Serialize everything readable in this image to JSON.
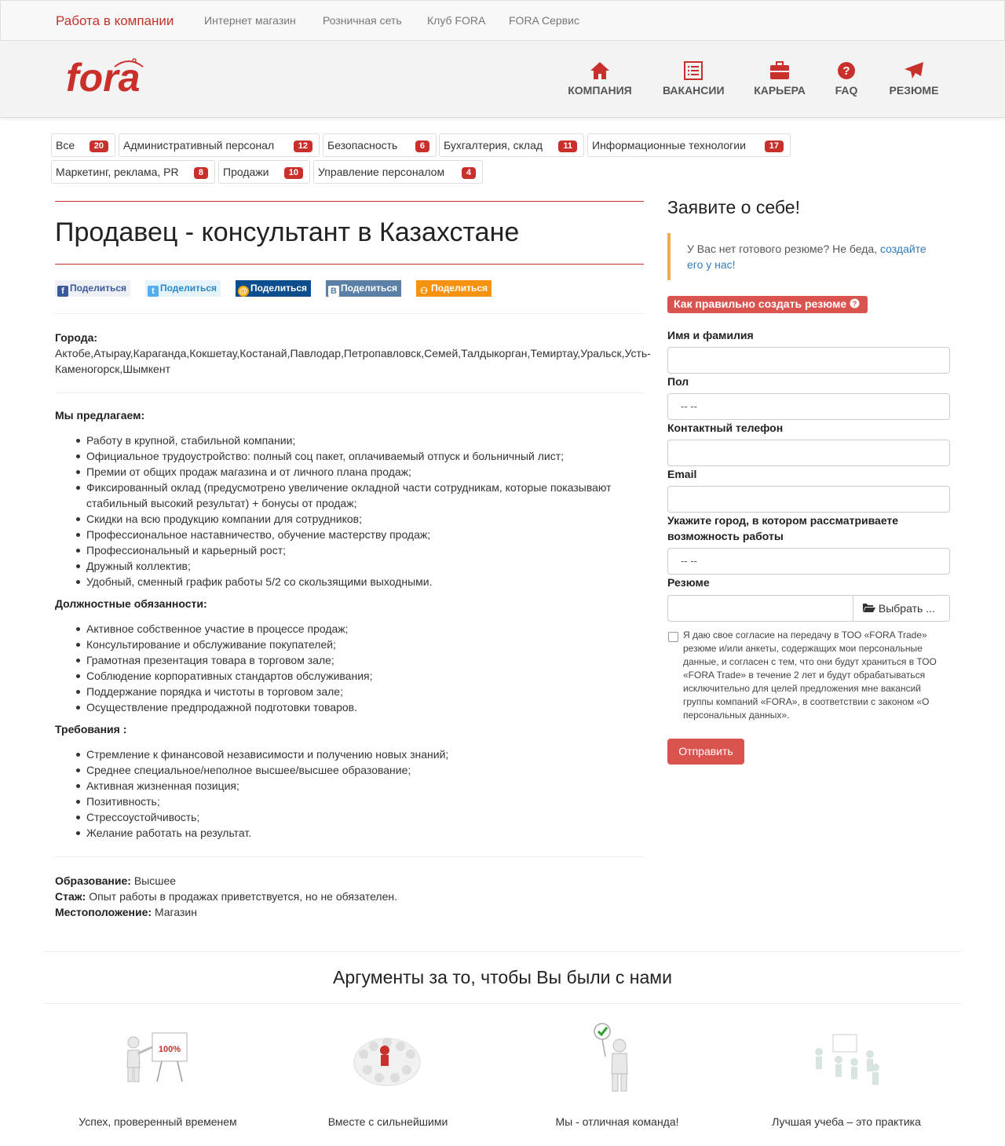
{
  "topnav": {
    "items": [
      "Работа в компании",
      "Интернет магазин",
      "Розничная сеть",
      "Клуб FORA",
      "FORA Сервис"
    ]
  },
  "header": {
    "logo_text": "fora",
    "brand_color": "#c9302c",
    "nav": [
      {
        "label": "КОМПАНИЯ",
        "icon": "home-icon"
      },
      {
        "label": "ВАКАНСИИ",
        "icon": "list-icon"
      },
      {
        "label": "КАРЬЕРА",
        "icon": "briefcase-icon"
      },
      {
        "label": "FAQ",
        "icon": "question-icon"
      },
      {
        "label": "РЕЗЮМЕ",
        "icon": "send-icon"
      }
    ]
  },
  "categories": [
    {
      "label": "Все",
      "count": "20"
    },
    {
      "label": "Административный персонал",
      "count": "12"
    },
    {
      "label": "Безопасность",
      "count": "6"
    },
    {
      "label": "Бухгалтерия, склад",
      "count": "11"
    },
    {
      "label": "Информационные технологии",
      "count": "17"
    },
    {
      "label": "Маркетинг, реклама, PR",
      "count": "8"
    },
    {
      "label": "Продажи",
      "count": "10"
    },
    {
      "label": "Управление персоналом",
      "count": "4"
    }
  ],
  "vacancy": {
    "title": "Продавец - консультант в Казахстане",
    "share": [
      {
        "label": "Поделиться",
        "network": "facebook",
        "icon": "facebook-icon",
        "color": "#3b5998"
      },
      {
        "label": "Поделиться",
        "network": "twitter",
        "icon": "twitter-icon",
        "color": "#55acee"
      },
      {
        "label": "Поделиться",
        "network": "mailru",
        "icon": "mailru-icon",
        "color": "#168de2"
      },
      {
        "label": "Поделиться",
        "network": "vk",
        "icon": "vk-icon",
        "color": "#5b7fa6"
      },
      {
        "label": "Поделиться",
        "network": "odnoklassniki",
        "icon": "ok-icon",
        "color": "#f59310"
      }
    ],
    "cities_label": "Города:",
    "cities_line1": "Актобе,Атырау,Караганда,Кокшетау,Костанай,Павлодар,Петропавловск,Семей,Талдыкорган,Темиртау,Уральск,Усть-",
    "cities_line2": "Каменогорск,Шымкент",
    "offer_title": "Мы предлагаем:",
    "offer": [
      "Работу в крупной, стабильной компании;",
      "Официальное трудоустройство: полный соц пакет, оплачиваемый отпуск и больничный лист;",
      "Премии от общих продаж магазина и от личного плана продаж;",
      "Фиксированный оклад (предусмотрено увеличение окладной части сотрудникам, которые показывают",
      "стабильный высокий результат) + бонусы от продаж;",
      "Скидки на всю продукцию компании для сотрудников;",
      "Профессиональное наставничество, обучение мастерству продаж;",
      "Профессиональный и карьерный рост;",
      "Дружный коллектив;",
      "Удобный, сменный график работы 5/2 со скользящими выходными."
    ],
    "duties_title": "Должностные обязанности:",
    "duties": [
      "Активное собственное участие в процессе продаж;",
      "Консультирование и обслуживание покупателей;",
      "Грамотная презентация товара в торговом зале;",
      "Соблюдение корпоративных стандартов обслуживания;",
      "Поддержание порядка и чистоты в торговом зале;",
      "Осуществление предпродажной подготовки товаров."
    ],
    "req_title": "Требования :",
    "req": [
      "Стремление к финансовой независимости и получению новых знаний;",
      "Среднее специальное/неполное высшее/высшее образование;",
      "Активная жизненная позиция;",
      "Позитивность;",
      "Стрессоустойчивость;",
      "Желание работать на результат."
    ],
    "education_label": "Образование:",
    "education": "Высшее",
    "experience_label": "Стаж:",
    "experience": "Опыт работы в продажах приветствуется, но не обязателен.",
    "location_label": "Местоположение:",
    "location": "Магазин"
  },
  "form": {
    "heading": "Заявите о себе!",
    "callout_text": "У Вас нет готового резюме? Не беда,",
    "callout_link1": "создайте",
    "callout_link2": "его у нас!",
    "howto": "Как правильно создать резюме",
    "name_label": "Имя и фамилия",
    "gender_label": "Пол",
    "gender_value": "-- --",
    "phone_label": "Контактный телефон",
    "email_label": "Email",
    "city_label_1": "Укажите город, в котором рассматриваете",
    "city_label_2": "возможность работы",
    "city_value": "-- --",
    "resume_label": "Резюме",
    "file_button": "Выбрать ...",
    "consent": [
      "Я даю свое согласие на передачу в ТОО «FORA Trade»",
      "резюме и/или анкеты, содержащих мои персональные",
      "данные, и согласен с тем, что они будут храниться в ТОО",
      "«FORA Trade» в течение 2 лет и будут обрабатываться",
      "исключительно для целей предложения мне вакансий",
      "группы компаний «FORA», в соответствии с законом «О",
      "персональных данных»."
    ],
    "submit": "Отправить",
    "accent": "#d9534f"
  },
  "arguments": {
    "title": "Аргументы за то, чтобы Вы были с нами",
    "chart_text": "100%",
    "items": [
      "Успех, проверенный временем",
      "Вместе с сильнейшими",
      "Мы - отличная команда!",
      "Лучшая учеба – это практика"
    ]
  }
}
